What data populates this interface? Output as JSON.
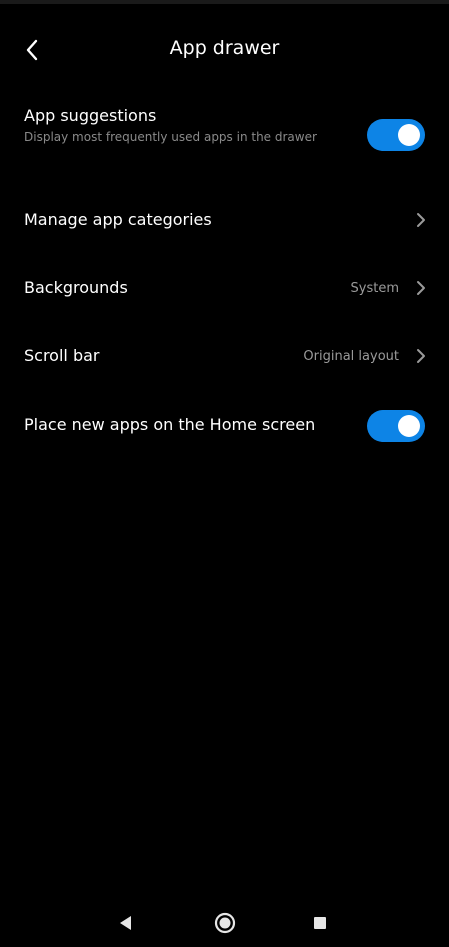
{
  "header": {
    "title": "App drawer",
    "back_icon": "chevron-left-icon"
  },
  "settings": {
    "app_suggestions": {
      "title": "App suggestions",
      "subtitle": "Display most frequently used apps in the drawer",
      "enabled": true
    },
    "manage_categories": {
      "title": "Manage app categories"
    },
    "backgrounds": {
      "title": "Backgrounds",
      "value": "System"
    },
    "scroll_bar": {
      "title": "Scroll bar",
      "value": "Original layout"
    },
    "place_new_apps": {
      "title": "Place new apps on the Home screen",
      "enabled": true
    }
  },
  "nav_bar": {
    "back": "triangle-back-icon",
    "home": "circle-home-icon",
    "recents": "square-recents-icon"
  },
  "colors": {
    "background": "#000000",
    "accent": "#0d84e6",
    "text_primary": "#ffffff",
    "text_secondary": "#8a8a8a"
  }
}
